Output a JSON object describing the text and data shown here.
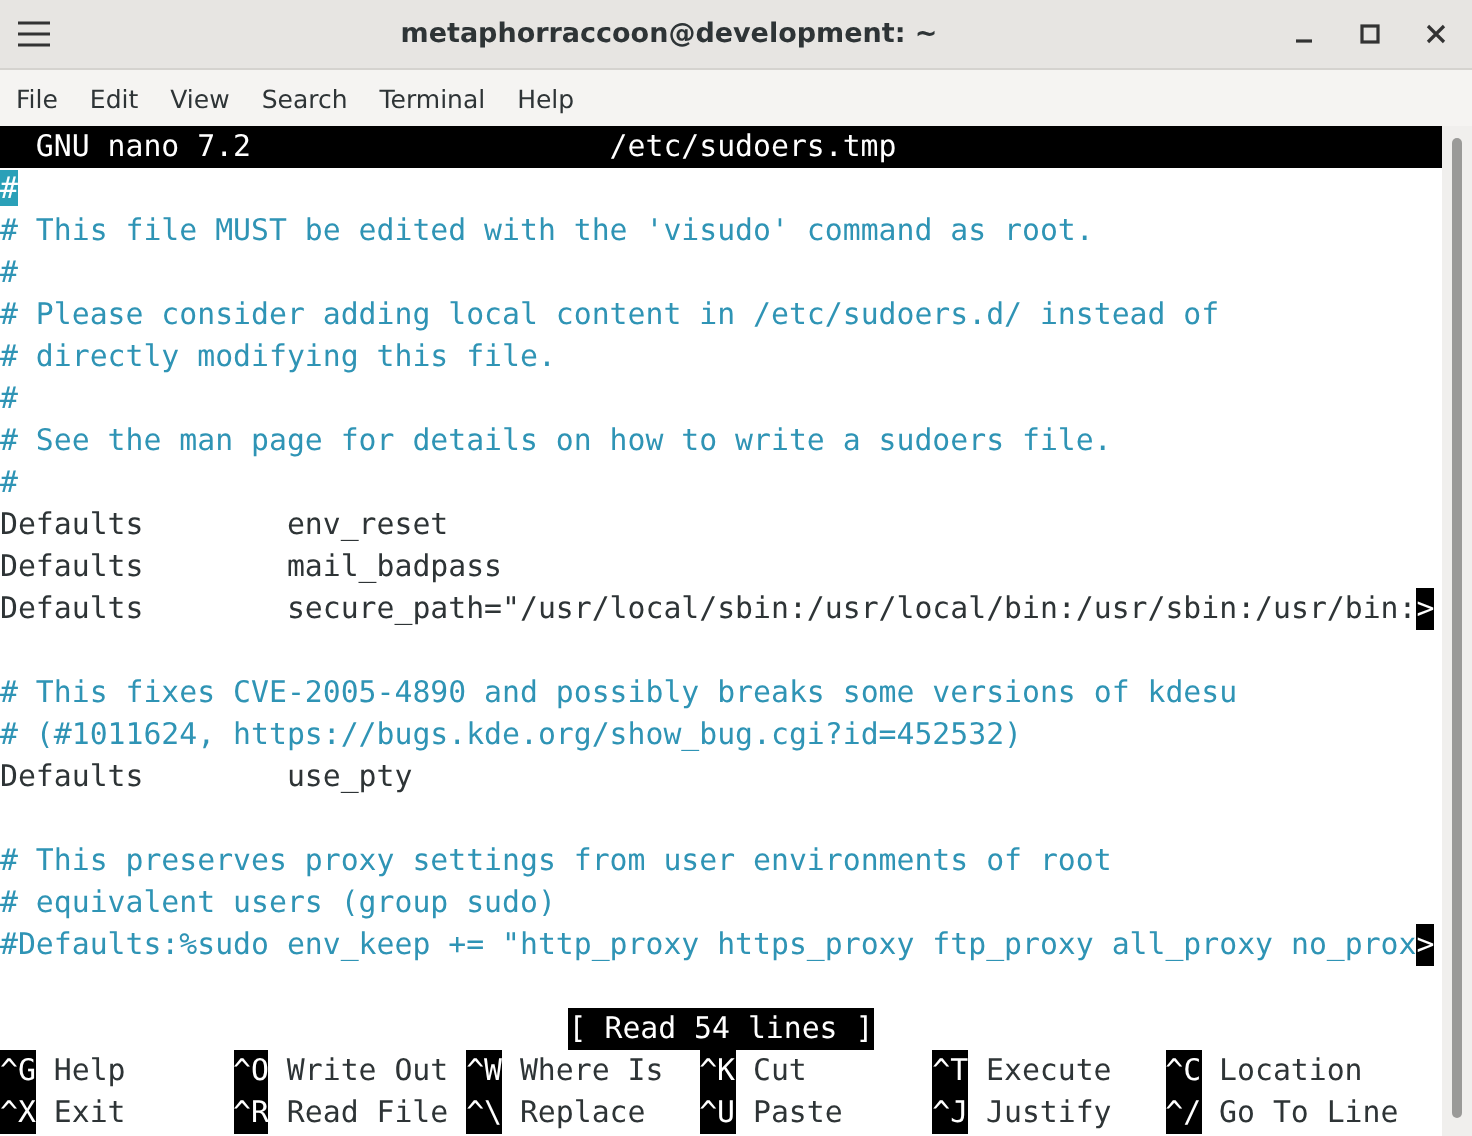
{
  "window": {
    "title": "metaphorraccoon@development: ~"
  },
  "menu": [
    "File",
    "Edit",
    "View",
    "Search",
    "Terminal",
    "Help"
  ],
  "editor": {
    "program": "GNU nano 7.2",
    "filename": "/etc/sudoers.tmp",
    "lines": [
      {
        "kind": "comment",
        "text": "#",
        "cursor": true
      },
      {
        "kind": "comment",
        "text": "# This file MUST be edited with the 'visudo' command as root.",
        "cursor": false
      },
      {
        "kind": "comment",
        "text": "#",
        "cursor": false
      },
      {
        "kind": "comment",
        "text": "# Please consider adding local content in /etc/sudoers.d/ instead of",
        "cursor": false
      },
      {
        "kind": "comment",
        "text": "# directly modifying this file.",
        "cursor": false
      },
      {
        "kind": "comment",
        "text": "#",
        "cursor": false
      },
      {
        "kind": "comment",
        "text": "# See the man page for details on how to write a sudoers file.",
        "cursor": false
      },
      {
        "kind": "comment",
        "text": "#",
        "cursor": false
      },
      {
        "kind": "code",
        "text": "Defaults        env_reset",
        "cursor": false
      },
      {
        "kind": "code",
        "text": "Defaults        mail_badpass",
        "cursor": false
      },
      {
        "kind": "code",
        "text": "Defaults        secure_path=\"/usr/local/sbin:/usr/local/bin:/usr/sbin:/usr/bin:",
        "overflow_mark": ">",
        "cursor": false
      },
      {
        "kind": "blank"
      },
      {
        "kind": "comment",
        "text": "# This fixes CVE-2005-4890 and possibly breaks some versions of kdesu",
        "cursor": false
      },
      {
        "kind": "comment",
        "text": "# (#1011624, https://bugs.kde.org/show_bug.cgi?id=452532)",
        "cursor": false
      },
      {
        "kind": "code",
        "text": "Defaults        use_pty",
        "cursor": false
      },
      {
        "kind": "blank"
      },
      {
        "kind": "comment",
        "text": "# This preserves proxy settings from user environments of root",
        "cursor": false
      },
      {
        "kind": "comment",
        "text": "# equivalent users (group sudo)",
        "cursor": false
      },
      {
        "kind": "comment",
        "text": "#Defaults:%sudo env_keep += \"http_proxy https_proxy ftp_proxy all_proxy no_prox",
        "overflow_mark": ">",
        "cursor": false
      },
      {
        "kind": "blank"
      }
    ],
    "status": "[ Read 54 lines ]",
    "shortcuts": [
      {
        "key": "^G",
        "label": "Help"
      },
      {
        "key": "^O",
        "label": "Write Out"
      },
      {
        "key": "^W",
        "label": "Where Is"
      },
      {
        "key": "^K",
        "label": "Cut"
      },
      {
        "key": "^T",
        "label": "Execute"
      },
      {
        "key": "^C",
        "label": "Location"
      },
      {
        "key": "^X",
        "label": "Exit"
      },
      {
        "key": "^R",
        "label": "Read File"
      },
      {
        "key": "^\\",
        "label": "Replace"
      },
      {
        "key": "^U",
        "label": "Paste"
      },
      {
        "key": "^J",
        "label": "Justify"
      },
      {
        "key": "^/",
        "label": "Go To Line"
      }
    ]
  }
}
